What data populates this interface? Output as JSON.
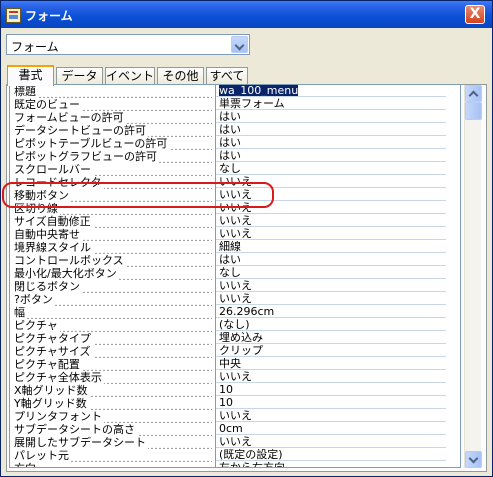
{
  "window": {
    "title": "フォーム",
    "close": "X"
  },
  "object_selector": {
    "value": "フォーム"
  },
  "tabs": [
    {
      "label": "書式"
    },
    {
      "label": "データ"
    },
    {
      "label": "イベント"
    },
    {
      "label": "その他"
    },
    {
      "label": "すべて"
    }
  ],
  "properties": [
    {
      "label": "標題",
      "value": "wa_100_menu"
    },
    {
      "label": "既定のビュー",
      "value": "単票フォーム"
    },
    {
      "label": "フォームビューの許可",
      "value": "はい"
    },
    {
      "label": "データシートビューの許可",
      "value": "はい"
    },
    {
      "label": "ピボットテーブルビューの許可",
      "value": "はい"
    },
    {
      "label": "ピボットグラフビューの許可",
      "value": "はい"
    },
    {
      "label": "スクロールバー",
      "value": "なし"
    },
    {
      "label": "レコードセレクタ",
      "value": "いいえ"
    },
    {
      "label": "移動ボタン",
      "value": "いいえ"
    },
    {
      "label": "区切り線",
      "value": "いいえ"
    },
    {
      "label": "サイズ自動修正",
      "value": "いいえ"
    },
    {
      "label": "自動中央寄せ",
      "value": "いいえ"
    },
    {
      "label": "境界線スタイル",
      "value": "細線"
    },
    {
      "label": "コントロールボックス",
      "value": "はい"
    },
    {
      "label": "最小化/最大化ボタン",
      "value": "なし"
    },
    {
      "label": "閉じるボタン",
      "value": "いいえ"
    },
    {
      "label": "?ボタン",
      "value": "いいえ"
    },
    {
      "label": "幅",
      "value": "26.296cm"
    },
    {
      "label": "ピクチャ",
      "value": "(なし)"
    },
    {
      "label": "ピクチャタイプ",
      "value": "埋め込み"
    },
    {
      "label": "ピクチャサイズ",
      "value": "クリップ"
    },
    {
      "label": "ピクチャ配置",
      "value": "中央"
    },
    {
      "label": "ピクチャ全体表示",
      "value": "いいえ"
    },
    {
      "label": "X軸グリッド数",
      "value": "10"
    },
    {
      "label": "Y軸グリッド数",
      "value": "10"
    },
    {
      "label": "プリンタフォント",
      "value": "いいえ"
    },
    {
      "label": "サブデータシートの高さ",
      "value": "0cm"
    },
    {
      "label": "展開したサブデータシート",
      "value": "いいえ"
    },
    {
      "label": "パレット元",
      "value": "(既定の設定)"
    },
    {
      "label": "方向",
      "value": "左から右方向"
    }
  ],
  "colors": {
    "titlebar": "#0a4fd4",
    "highlight": "#d91a1a",
    "selected": "#0a246a"
  }
}
